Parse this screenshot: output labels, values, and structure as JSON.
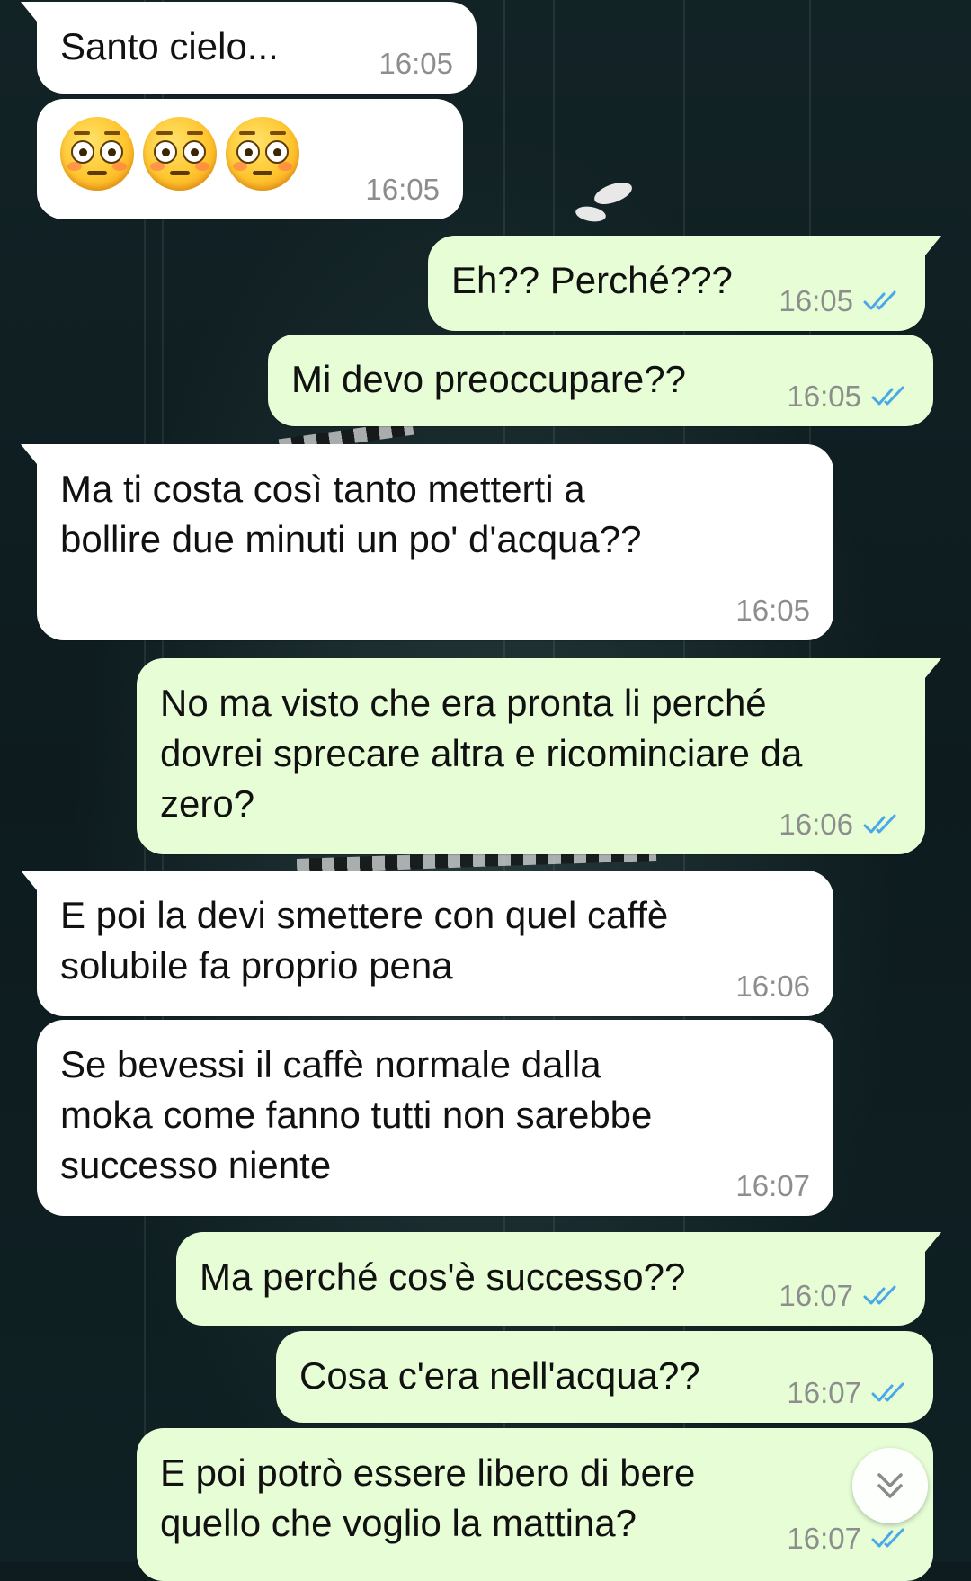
{
  "conversation": {
    "messages": [
      {
        "direction": "incoming",
        "text": "Santo cielo...",
        "time": "16:05"
      },
      {
        "direction": "incoming",
        "emoji": [
          "flushed-face",
          "flushed-face",
          "flushed-face"
        ],
        "time": "16:05"
      },
      {
        "direction": "outgoing",
        "text": "Eh?? Perché???",
        "time": "16:05",
        "status": "read"
      },
      {
        "direction": "outgoing",
        "text": "Mi devo preoccupare??",
        "time": "16:05",
        "status": "read"
      },
      {
        "direction": "incoming",
        "text": "Ma ti costa così tanto metterti a\nbollire due minuti un po' d'acqua??",
        "time": "16:05"
      },
      {
        "direction": "outgoing",
        "text": "No ma visto che era pronta li perché\ndovrei sprecare altra e ricominciare da\nzero?",
        "time": "16:06",
        "status": "read"
      },
      {
        "direction": "incoming",
        "text": "E poi la devi smettere con quel caffè\nsolubile fa proprio pena",
        "time": "16:06"
      },
      {
        "direction": "incoming",
        "text": "Se bevessi il caffè normale dalla\nmoka come fanno tutti non sarebbe\nsuccesso niente",
        "time": "16:07"
      },
      {
        "direction": "outgoing",
        "text": "Ma perché cos'è successo??",
        "time": "16:07",
        "status": "read"
      },
      {
        "direction": "outgoing",
        "text": "Cosa c'era nell'acqua??",
        "time": "16:07",
        "status": "read"
      },
      {
        "direction": "outgoing",
        "text": "E poi potrò essere libero di bere\nquello che voglio la mattina?",
        "time": "16:07",
        "status": "read"
      }
    ]
  },
  "colors": {
    "incoming_bubble": "#ffffff",
    "outgoing_bubble": "#e6fdd6",
    "read_ticks": "#4aa8e8",
    "timestamp": "#8d8d8d"
  },
  "controls": {
    "scroll_down_icon": "double-chevron-down-icon"
  }
}
